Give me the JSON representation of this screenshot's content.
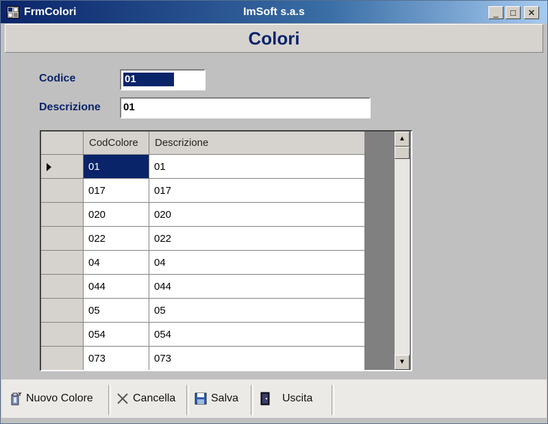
{
  "window": {
    "title": "FrmColori",
    "center_title": "ImSoft s.a.s",
    "minimize": "_",
    "maximize": "□",
    "close": "✕"
  },
  "header": {
    "title": "Colori"
  },
  "form": {
    "codice_label": "Codice",
    "codice_value": "01",
    "descrizione_label": "Descrizione",
    "descrizione_value": "01"
  },
  "grid": {
    "columns": [
      "CodColore",
      "Descrizione"
    ],
    "rows": [
      {
        "cod": "01",
        "desc": "01"
      },
      {
        "cod": "017",
        "desc": "017"
      },
      {
        "cod": "020",
        "desc": "020"
      },
      {
        "cod": "022",
        "desc": "022"
      },
      {
        "cod": "04",
        "desc": "04"
      },
      {
        "cod": "044",
        "desc": "044"
      },
      {
        "cod": "05",
        "desc": "05"
      },
      {
        "cod": "054",
        "desc": "054"
      },
      {
        "cod": "073",
        "desc": "073"
      }
    ],
    "current_row": 0
  },
  "toolbar": {
    "nuovo_label": "Nuovo Colore",
    "cancella_label": "Cancella",
    "salva_label": "Salva",
    "uscita_label": "Uscita"
  },
  "icons": {
    "app": "app-form-icon",
    "nuovo": "new-color-icon",
    "cancella": "delete-x-icon",
    "salva": "floppy-save-icon",
    "uscita": "exit-door-icon"
  },
  "colors": {
    "accent": "#0a246a",
    "titlebar_end": "#a6caf0",
    "background": "#c0c0c0"
  }
}
